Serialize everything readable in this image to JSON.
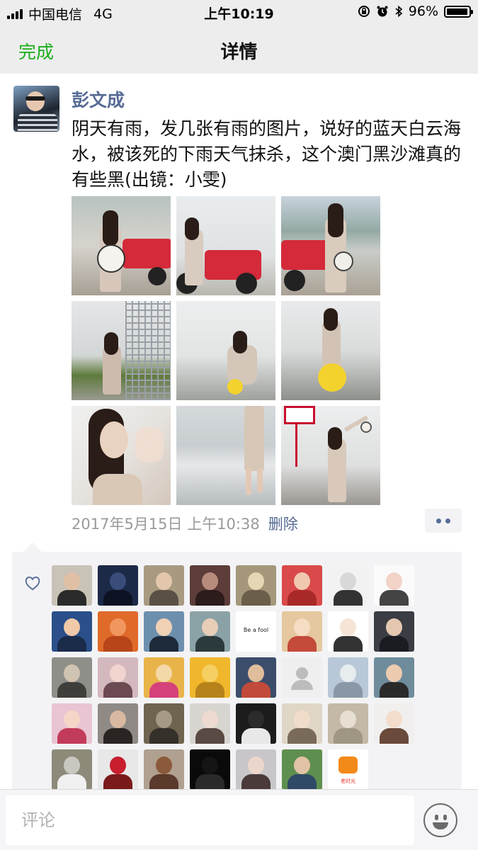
{
  "status_bar": {
    "carrier": "中国电信",
    "network": "4G",
    "time": "上午10:19",
    "battery": "96%",
    "battery_level": 0.96
  },
  "nav": {
    "done_label": "完成",
    "title": "详情"
  },
  "post": {
    "username": "彭文成",
    "text": "阴天有雨，发几张有雨的图片，说好的蓝天白云海水，被该死的下雨天气抹杀，这个澳门黑沙滩真的有些黑(出镜：小雯)",
    "timestamp": "2017年5月15日 上午10:38",
    "delete_label": "删除",
    "photos": [
      {
        "scene": "woman-with-hat-and-red-atv"
      },
      {
        "scene": "woman-sitting-on-red-atv-beach"
      },
      {
        "scene": "woman-by-red-atv-near-hills"
      },
      {
        "scene": "woman-sitting-by-fence"
      },
      {
        "scene": "woman-sitting-on-beach-with-yellow-buoy"
      },
      {
        "scene": "woman-with-hat-and-yellow-buoy"
      },
      {
        "scene": "woman-reaching-hand-close-up"
      },
      {
        "scene": "legs-walking-in-surf"
      },
      {
        "scene": "woman-holding-hat-up-beach"
      }
    ]
  },
  "likes": {
    "icon": "heart-outline-icon",
    "likers": [
      {
        "name": "liker-1"
      },
      {
        "name": "liker-2"
      },
      {
        "name": "liker-3"
      },
      {
        "name": "liker-4"
      },
      {
        "name": "liker-5"
      },
      {
        "name": "liker-6"
      },
      {
        "name": "liker-7"
      },
      {
        "name": "liker-8"
      },
      {
        "name": "liker-9"
      },
      {
        "name": "liker-10"
      },
      {
        "name": "liker-11"
      },
      {
        "name": "liker-12"
      },
      {
        "name": "liker-13",
        "text": "Be a fool"
      },
      {
        "name": "liker-14"
      },
      {
        "name": "liker-15"
      },
      {
        "name": "liker-16"
      },
      {
        "name": "liker-17"
      },
      {
        "name": "liker-18"
      },
      {
        "name": "liker-19"
      },
      {
        "name": "liker-20"
      },
      {
        "name": "liker-21"
      },
      {
        "name": "liker-22"
      },
      {
        "name": "liker-23"
      },
      {
        "name": "liker-24"
      },
      {
        "name": "liker-25"
      },
      {
        "name": "liker-26"
      },
      {
        "name": "liker-27"
      },
      {
        "name": "liker-28"
      },
      {
        "name": "liker-29"
      },
      {
        "name": "liker-30"
      },
      {
        "name": "liker-31"
      },
      {
        "name": "liker-32"
      },
      {
        "name": "liker-33"
      },
      {
        "name": "liker-34"
      },
      {
        "name": "liker-35"
      },
      {
        "name": "liker-36"
      },
      {
        "name": "liker-37"
      },
      {
        "name": "liker-38"
      },
      {
        "name": "liker-39",
        "text": "老时光"
      }
    ]
  },
  "comment_bar": {
    "placeholder": "评论",
    "emoji_icon": "smiley-face-icon"
  },
  "colors": {
    "accent_green": "#1aad19",
    "link_blue": "#576b95",
    "nav_background": "#ededed",
    "likes_background": "#f3f3f5"
  }
}
